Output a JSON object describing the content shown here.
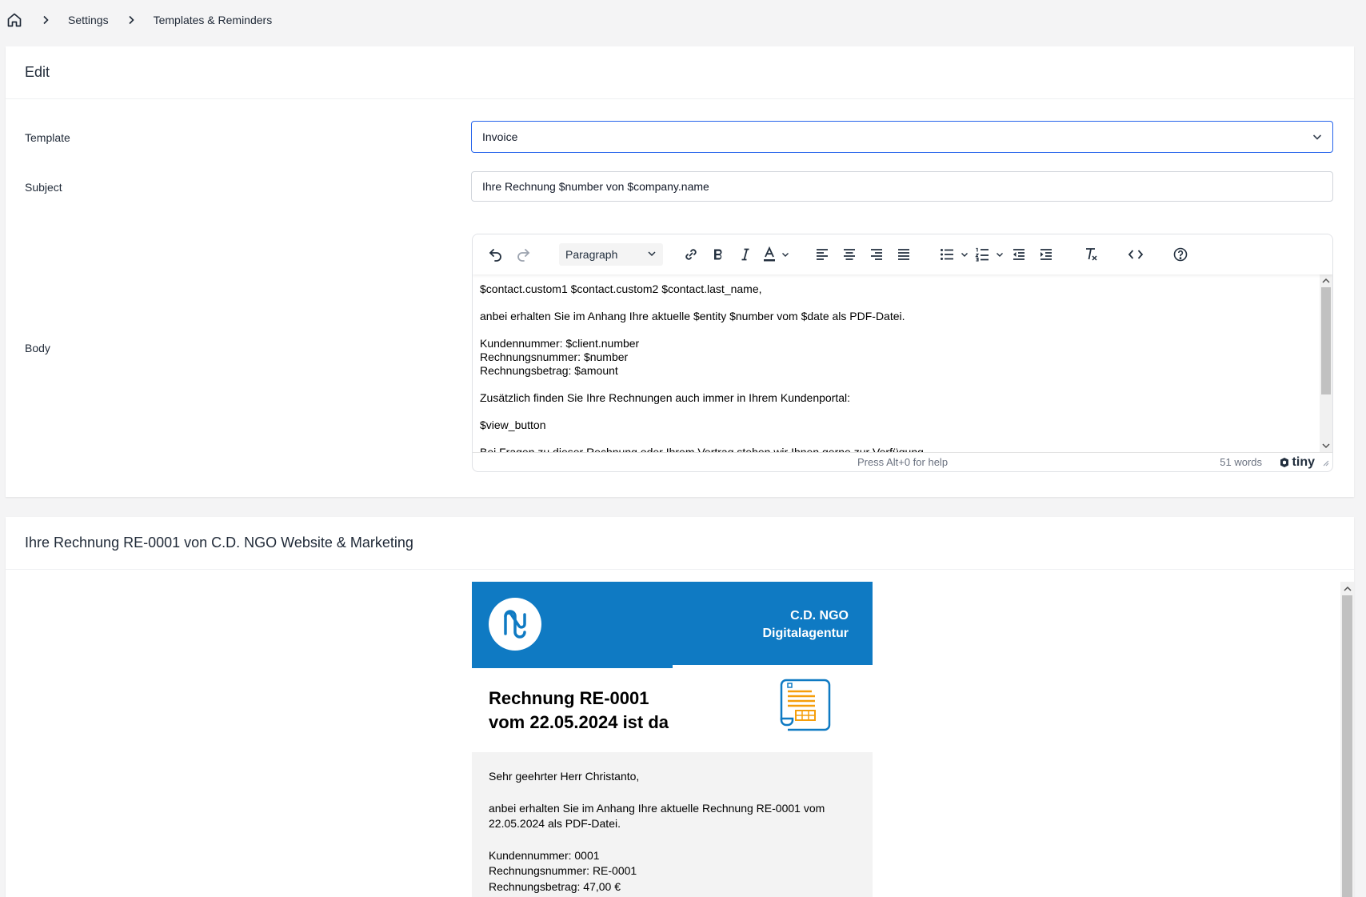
{
  "breadcrumb": {
    "home_icon": "home-icon",
    "items": [
      "Settings",
      "Templates & Reminders"
    ]
  },
  "edit_card": {
    "title": "Edit",
    "template_label": "Template",
    "template_value": "Invoice",
    "subject_label": "Subject",
    "subject_value": "Ihre Rechnung $number von $company.name",
    "body_label": "Body"
  },
  "editor": {
    "format_value": "Paragraph",
    "icons": [
      "undo-icon",
      "redo-icon",
      "link-icon",
      "bold-icon",
      "italic-icon",
      "text-color-icon",
      "align-left-icon",
      "align-center-icon",
      "align-right-icon",
      "justify-icon",
      "bullet-list-icon",
      "numbered-list-icon",
      "outdent-icon",
      "indent-icon",
      "clear-format-icon",
      "source-code-icon",
      "help-icon"
    ],
    "lines": {
      "greeting": "$contact.custom1 $contact.custom2 $contact.last_name,",
      "intro": "anbei erhalten Sie im Anhang Ihre aktuelle $entity $number vom $date als PDF-Datei.",
      "client_number": "Kundennummer: $client.number",
      "invoice_number": "Rechnungsnummer: $number",
      "amount": "Rechnungsbetrag: $amount",
      "portal": "Zusätzlich finden Sie Ihre Rechnungen auch immer in Ihrem Kundenportal:",
      "button": "$view_button",
      "cut": "Bei Fragen zu dieser Rechnung oder Ihrem Vertrag stehen wir Ihnen gerne zur Verfügung."
    },
    "status_help": "Press Alt+0 for help",
    "word_count": "51 words",
    "brand": "tiny"
  },
  "preview_card": {
    "title": "Ihre Rechnung RE-0001 von C.D. NGO Website & Marketing",
    "email": {
      "brand_color": "#0f7ac3",
      "company_line1": "C.D. NGO",
      "company_line2": "Digitalagentur",
      "heading_line1": "Rechnung RE-0001",
      "heading_line2": "vom 22.05.2024 ist da",
      "salutation": "Sehr geehrter Herr Christanto,",
      "intro": "anbei erhalten Sie im Anhang Ihre aktuelle Rechnung RE-0001 vom 22.05.2024 als PDF-Datei.",
      "client_number": "Kundennummer: 0001",
      "invoice_number": "Rechnungsnummer: RE-0001",
      "amount": "Rechnungsbetrag: 47,00 €"
    }
  }
}
